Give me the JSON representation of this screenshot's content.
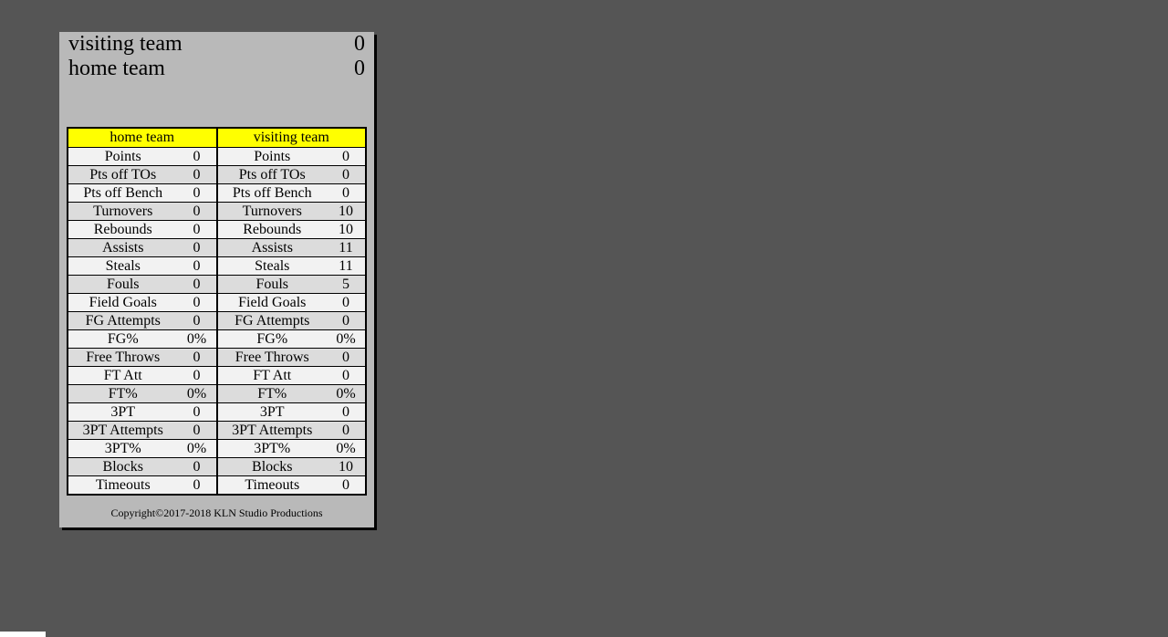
{
  "score": {
    "visiting_name": "visiting team",
    "visiting_value": "0",
    "home_name": "home team",
    "home_value": "0"
  },
  "headers": {
    "left": "home team",
    "right": "visiting team"
  },
  "stats": [
    {
      "label": "Points",
      "home": "0",
      "visit": "0"
    },
    {
      "label": "Pts off TOs",
      "home": "0",
      "visit": "0"
    },
    {
      "label": "Pts off Bench",
      "home": "0",
      "visit": "0"
    },
    {
      "label": "Turnovers",
      "home": "0",
      "visit": "10"
    },
    {
      "label": "Rebounds",
      "home": "0",
      "visit": "10"
    },
    {
      "label": "Assists",
      "home": "0",
      "visit": "11"
    },
    {
      "label": "Steals",
      "home": "0",
      "visit": "11"
    },
    {
      "label": "Fouls",
      "home": "0",
      "visit": "5"
    },
    {
      "label": "Field Goals",
      "home": "0",
      "visit": "0"
    },
    {
      "label": "FG Attempts",
      "home": "0",
      "visit": "0"
    },
    {
      "label": "FG%",
      "home": "0%",
      "visit": "0%"
    },
    {
      "label": "Free Throws",
      "home": "0",
      "visit": "0"
    },
    {
      "label": "FT Att",
      "home": "0",
      "visit": "0"
    },
    {
      "label": "FT%",
      "home": "0%",
      "visit": "0%"
    },
    {
      "label": "3PT",
      "home": "0",
      "visit": "0"
    },
    {
      "label": "3PT Attempts",
      "home": "0",
      "visit": "0"
    },
    {
      "label": "3PT%",
      "home": "0%",
      "visit": "0%"
    },
    {
      "label": "Blocks",
      "home": "0",
      "visit": "10"
    },
    {
      "label": "Timeouts",
      "home": "0",
      "visit": "0"
    }
  ],
  "copyright": "Copyright©2017-2018 KLN Studio Productions"
}
